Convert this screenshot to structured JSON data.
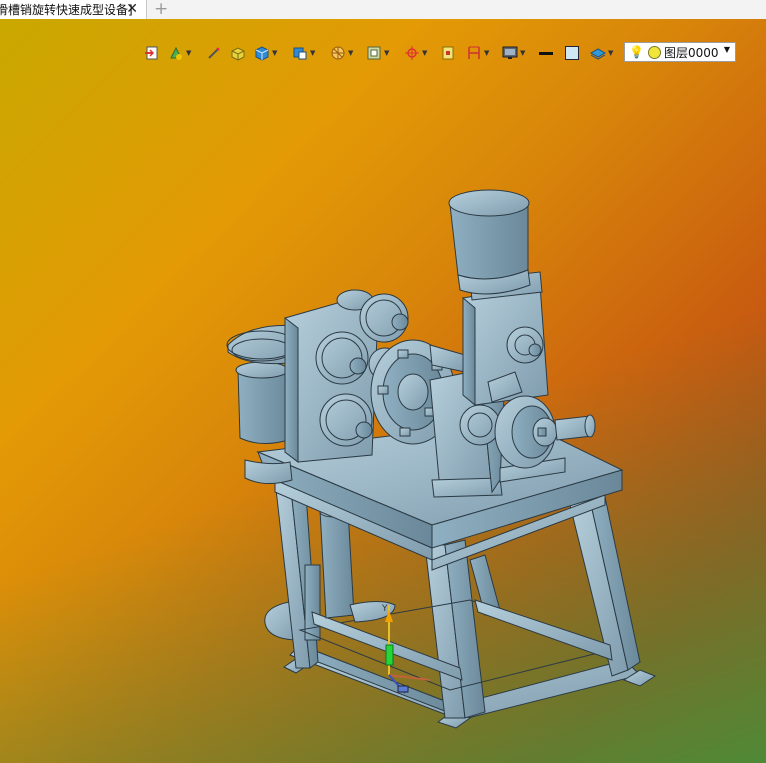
{
  "tab": {
    "title": "滑槽销旋转快速成型设备]",
    "close_glyph": "✕",
    "new_tab_glyph": "+"
  },
  "toolbar": {
    "tools": [
      "import-icon",
      "paint-icon",
      "edit-icon",
      "box-yellow-icon",
      "cube-icon",
      "view-cube-icon",
      "section-icon",
      "display-icon",
      "axis-icon",
      "bounds-icon",
      "monitor-icon",
      "line-icon",
      "color-square-icon",
      "layers-icon"
    ],
    "layer": {
      "bulb": "💡",
      "label": "图层0000",
      "dot_color": "#f2e53a"
    }
  },
  "viewport": {
    "gradient_top": "#d2aa00",
    "gradient_mid": "#e39a05",
    "gradient_bottom_left": "#c84a10",
    "gradient_bottom_right": "#4f9a3a",
    "part_color": "#9ab8c8",
    "triad": {
      "y_label": "Y"
    }
  }
}
